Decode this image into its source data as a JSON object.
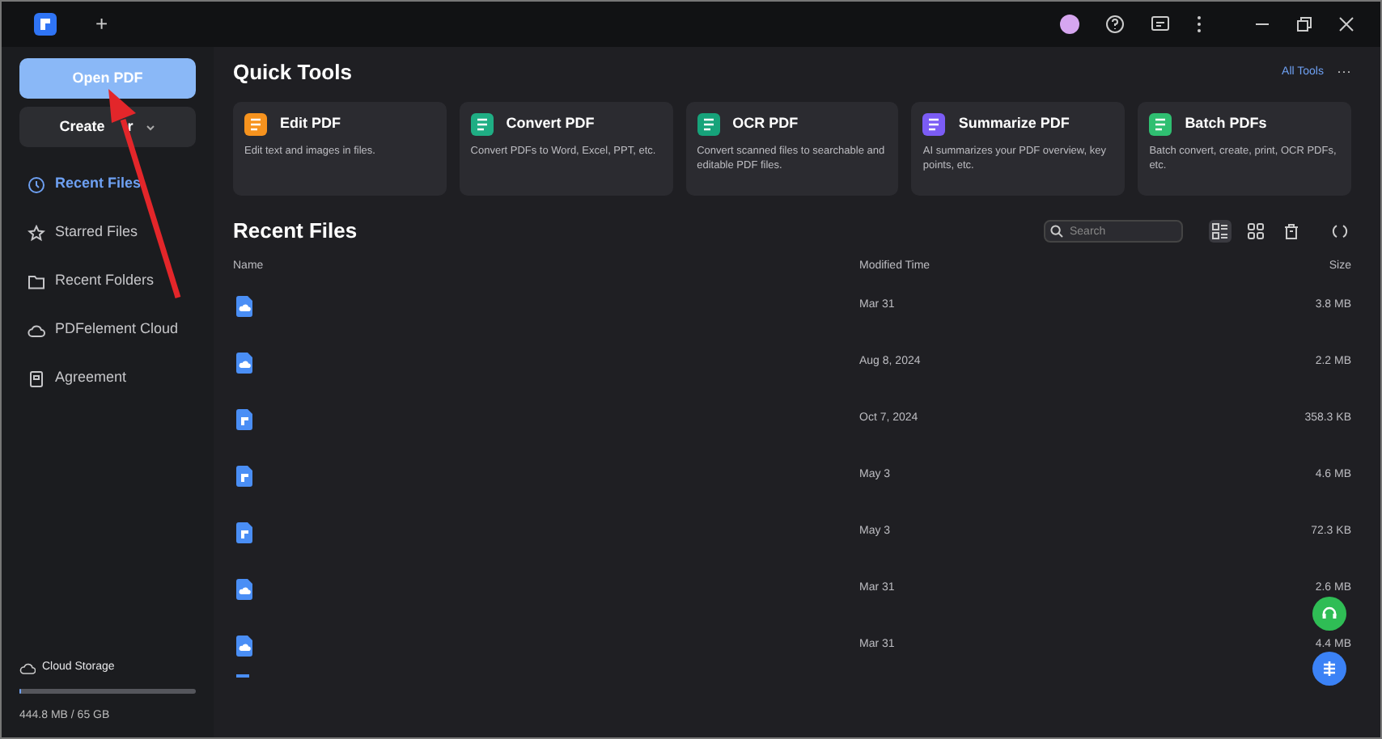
{
  "title_bar": {
    "new_tab": "+"
  },
  "sidebar": {
    "open_button": "Open PDF",
    "create_button": {
      "label_start": "Create",
      "label_end": "r"
    },
    "items": [
      {
        "label": "Recent Files",
        "kind": "clock",
        "selected": true
      },
      {
        "label": "Starred Files",
        "kind": "star",
        "selected": false
      },
      {
        "label": "Recent Folders",
        "kind": "folder",
        "selected": false
      },
      {
        "label": "PDFelement Cloud",
        "kind": "cloud",
        "selected": false
      },
      {
        "label": "Agreement",
        "kind": "doc",
        "selected": false
      }
    ],
    "storage": {
      "label": "Cloud Storage",
      "level": 0.01,
      "usage": "444.8 MB / 65 GB"
    }
  },
  "quick_tools": {
    "title": "Quick Tools",
    "all_tools": "All Tools",
    "more": "···",
    "tools": [
      {
        "name": "Edit PDF",
        "description": "Edit text and images in files.",
        "color": "#f7931e"
      },
      {
        "name": "Convert PDF",
        "description": "Convert PDFs to Word, Excel, PPT, etc.",
        "color": "#1fae84"
      },
      {
        "name": "OCR PDF",
        "description": "Convert scanned files to searchable and editable PDF files.",
        "color": "#16a37a"
      },
      {
        "name": "Summarize PDF",
        "description": "AI summarizes your PDF overview, key points, etc.",
        "color": "#7b5cf5"
      },
      {
        "name": "Batch PDFs",
        "description": "Batch convert, create, print, OCR PDFs, etc.",
        "color": "#2fbf71"
      }
    ]
  },
  "recent_files": {
    "title": "Recent Files",
    "search_placeholder": "Search",
    "columns": [
      "Name",
      "Modified Time",
      "Size"
    ],
    "rows": [
      {
        "kind": "cloud",
        "modified": "Mar 31",
        "size": "3.8 MB"
      },
      {
        "kind": "cloud",
        "modified": "Aug 8, 2024",
        "size": "2.2 MB"
      },
      {
        "kind": "pdf",
        "modified": "Oct 7, 2024",
        "size": "358.3 KB"
      },
      {
        "kind": "pdf",
        "modified": "May 3",
        "size": "4.6 MB"
      },
      {
        "kind": "pdf",
        "modified": "May 3",
        "size": "72.3 KB"
      },
      {
        "kind": "cloud",
        "modified": "Mar 31",
        "size": "2.6 MB"
      },
      {
        "kind": "cloud",
        "modified": "Mar 31",
        "size": "4.4 MB"
      }
    ]
  }
}
